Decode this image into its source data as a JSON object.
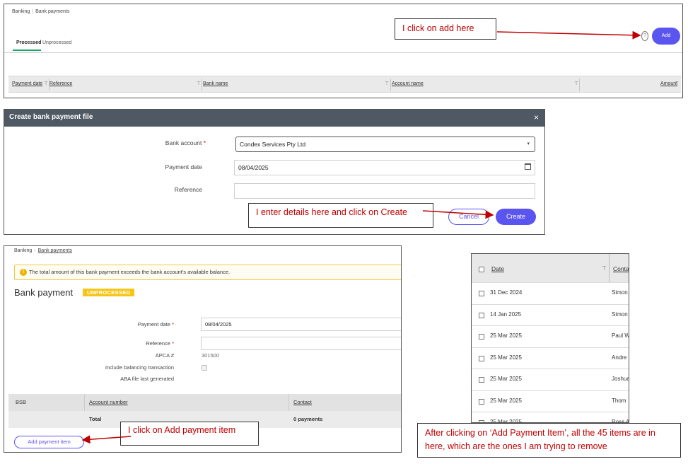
{
  "panel1": {
    "breadcrumb": [
      "Banking",
      "Bank payments"
    ],
    "tabs": [
      "Processed",
      "Unprocessed"
    ],
    "columns": [
      "Payment date",
      "Reference",
      "Bank name",
      "Account name",
      "Amount"
    ],
    "filter_glyph": "⊤",
    "add_label": "Add",
    "help_glyph": "?"
  },
  "callout1": "I click on add here",
  "dialog": {
    "title": "Create bank payment file",
    "close_glyph": "×",
    "bank_account_label": "Bank account",
    "bank_account_value": "Condex Services Pty Ltd",
    "payment_date_label": "Payment date",
    "payment_date_value": "08/04/2025",
    "reference_label": "Reference",
    "reference_value": "",
    "cancel_label": "Cancel",
    "create_label": "Create",
    "required_mark": "*",
    "select_arrow": "▾"
  },
  "callout2": "I enter details here and click on Create",
  "panel3": {
    "breadcrumb": [
      "Banking",
      "Bank payments"
    ],
    "alert": "The total amount of this bank payment exceeds the bank account's available balance.",
    "alert_glyph": "!",
    "title": "Bank payment",
    "badge": "UNPROCESSED",
    "payment_date_label": "Payment date",
    "payment_date_value": "08/04/2025",
    "reference_label": "Reference",
    "apca_label": "APCA #",
    "apca_value": "301500",
    "balancing_label": "Include balancing transaction",
    "aba_label": "ABA file last generated",
    "columns": [
      "BSB",
      "Account number",
      "Contact"
    ],
    "total_label": "Total",
    "total_payments": "0 payments",
    "add_item_label": "Add payment item"
  },
  "callout3": "I click on Add payment item",
  "panel4": {
    "header_date": "Date",
    "header_contact": "Conta",
    "rows": [
      {
        "date": "31 Dec 2024",
        "contact": "Simon"
      },
      {
        "date": "14 Jan 2025",
        "contact": "Simon"
      },
      {
        "date": "25 Mar 2025",
        "contact": "Paul W"
      },
      {
        "date": "25 Mar 2025",
        "contact": "Andre"
      },
      {
        "date": "25 Mar 2025",
        "contact": "Joshua"
      },
      {
        "date": "25 Mar 2025",
        "contact": "Thom"
      },
      {
        "date": "25 Mar 2025",
        "contact": "Ross A"
      }
    ]
  },
  "callout4": "After clicking on ‘Add Payment Item’, all the 45 items are in here, which are the ones I am trying to remove",
  "colors": {
    "accent": "#5b55f0",
    "callout_text": "#c00000",
    "arrow": "#c00000",
    "badge": "#f5c518",
    "tab_active": "#1aa56a"
  }
}
